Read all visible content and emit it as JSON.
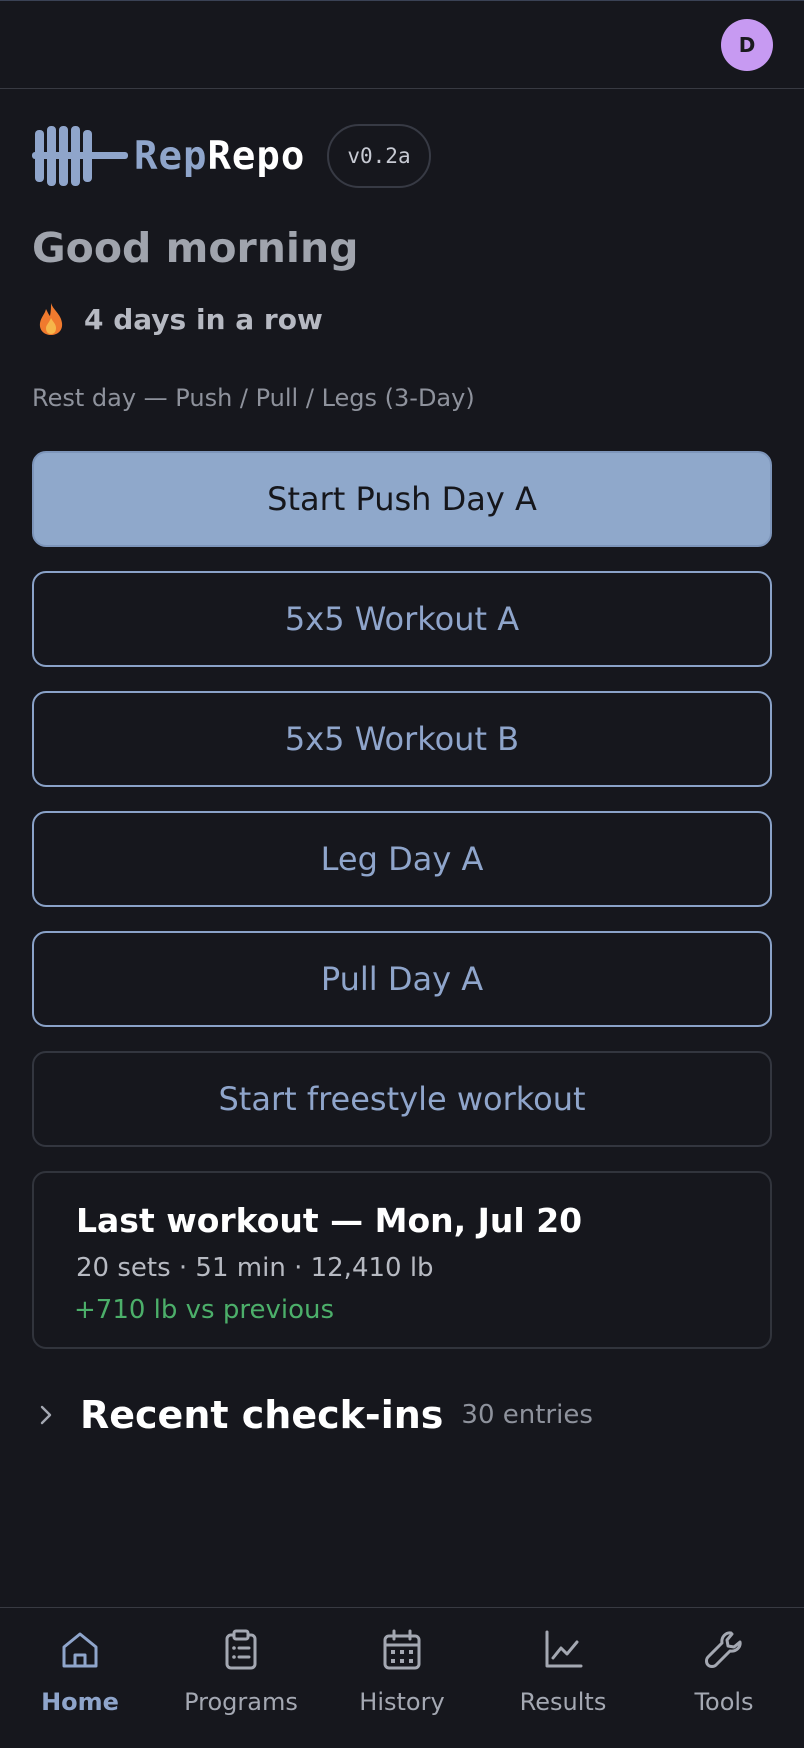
{
  "user": {
    "avatar_initial": "D"
  },
  "brand": {
    "name_part1": "Rep",
    "name_part2": "Repo",
    "version": "v0.2a"
  },
  "greeting": "Good morning",
  "streak": {
    "icon": "flame-icon",
    "text": "4 days in a row"
  },
  "rest_line": "Rest day — Push / Pull / Legs (3-Day)",
  "primary_action": {
    "label": "Start Push Day A"
  },
  "workouts": [
    {
      "label": "5x5 Workout A"
    },
    {
      "label": "5x5 Workout B"
    },
    {
      "label": "Leg Day A"
    },
    {
      "label": "Pull Day A"
    }
  ],
  "freestyle": {
    "label": "Start freestyle workout"
  },
  "last_workout": {
    "title": "Last workout — Mon, Jul 20",
    "stats": "20 sets · 51 min · 12,410 lb",
    "delta": "+710 lb vs previous"
  },
  "recent": {
    "title": "Recent check-ins",
    "count": "30 entries"
  },
  "nav": {
    "items": [
      {
        "label": "Home",
        "icon": "home-icon",
        "active": true
      },
      {
        "label": "Programs",
        "icon": "clipboard-icon",
        "active": false
      },
      {
        "label": "History",
        "icon": "calendar-icon",
        "active": false
      },
      {
        "label": "Results",
        "icon": "chart-line-icon",
        "active": false
      },
      {
        "label": "Tools",
        "icon": "wrench-icon",
        "active": false
      }
    ]
  },
  "colors": {
    "background": "#16171d",
    "accent": "#8fa5cb",
    "avatar": "#c79af2",
    "success": "#4caf6a",
    "flame": "#f07a2e"
  }
}
